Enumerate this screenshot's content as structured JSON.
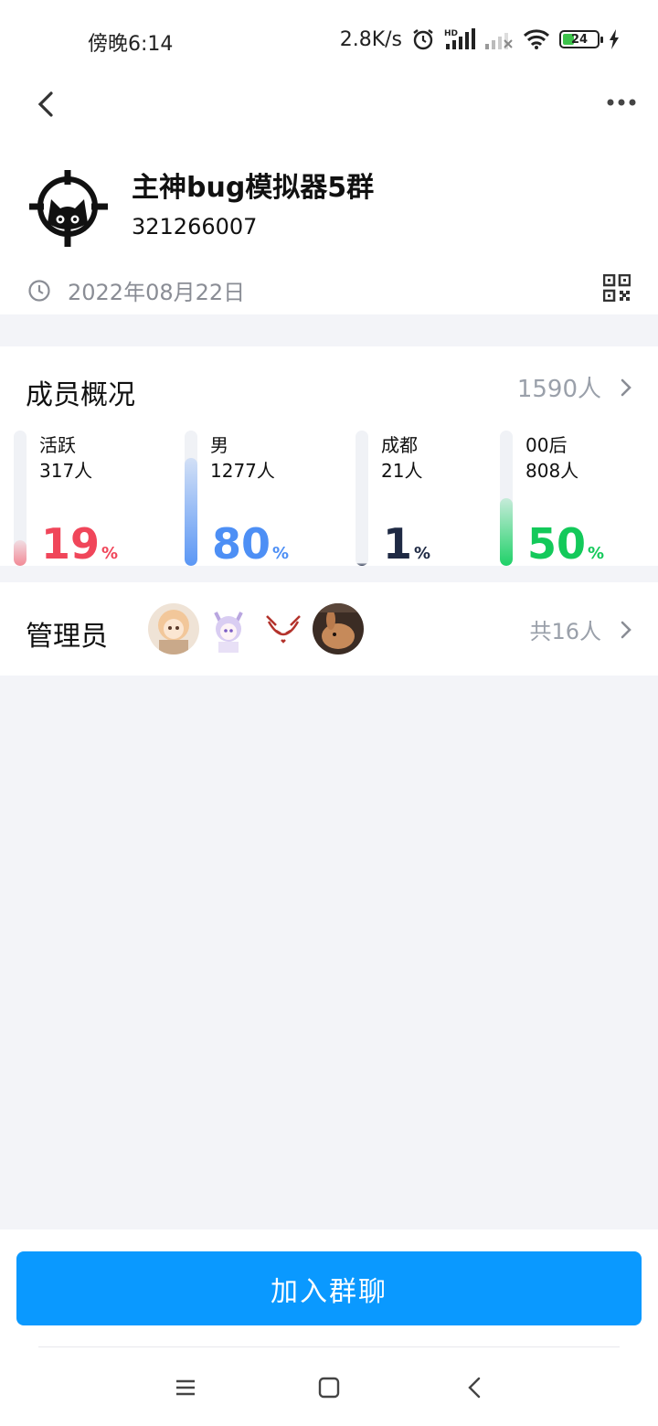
{
  "status_bar": {
    "time": "傍晚6:14",
    "net_speed": "2.8K/s",
    "battery": "24",
    "icons": [
      "alarm-icon",
      "hd-signal-icon",
      "signal-weak-icon",
      "wifi-icon",
      "battery-icon",
      "charging-icon"
    ]
  },
  "header": {
    "back_icon": "chevron-left-icon",
    "more_icon": "more-horizontal-icon",
    "group_name": "主神bug模拟器5群",
    "group_id": "321266007",
    "created_date": "2022年08月22日",
    "clock_icon": "clock-icon",
    "qr_icon": "qr-code-icon"
  },
  "members": {
    "title": "成员概况",
    "count": "1590人",
    "stats": [
      {
        "label": "活跃",
        "sub": "317人",
        "percent": "19",
        "unit": "%",
        "fill": 0.19,
        "color": "#f0465a",
        "fill_color": "#f28a96"
      },
      {
        "label": "男",
        "sub": "1277人",
        "percent": "80",
        "unit": "%",
        "fill": 0.8,
        "color": "#4d8ff5",
        "fill_color": "#5b97f5"
      },
      {
        "label": "成都",
        "sub": "21人",
        "percent": "1",
        "unit": "%",
        "fill": 0.01,
        "color": "#1f2a44",
        "fill_color": "#2b3550"
      },
      {
        "label": "00后",
        "sub": "808人",
        "percent": "50",
        "unit": "%",
        "fill": 0.5,
        "color": "#13c95a",
        "fill_color": "#1fd168"
      }
    ]
  },
  "admins": {
    "title": "管理员",
    "count": "共16人"
  },
  "join_button": "加入群聊",
  "navbar": {
    "icons": [
      "menu-icon",
      "home-icon",
      "back-icon"
    ]
  }
}
